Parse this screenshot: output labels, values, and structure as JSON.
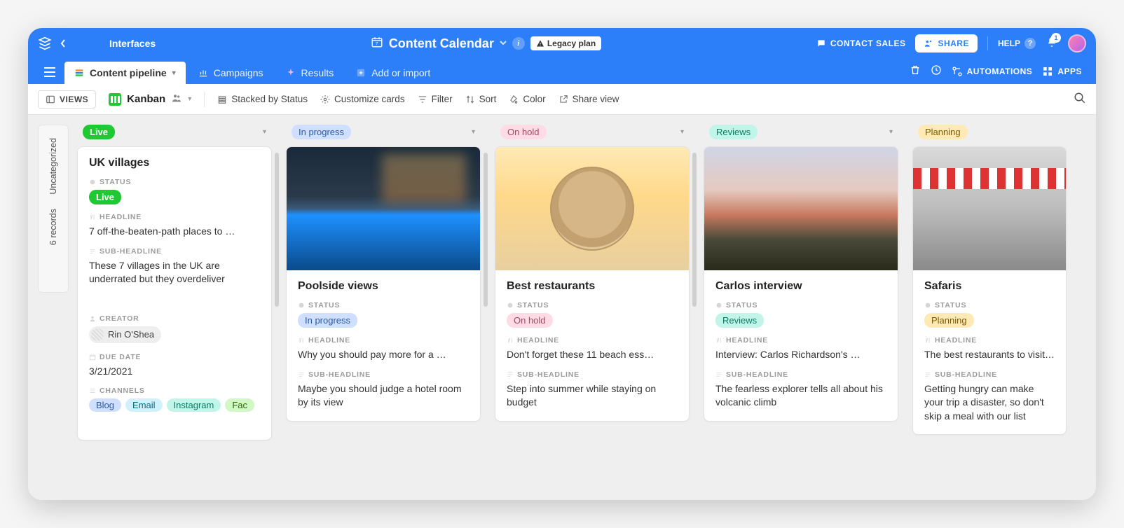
{
  "header": {
    "interfaces": "Interfaces",
    "base_title": "Content Calendar",
    "legacy": "Legacy plan",
    "contact_sales": "CONTACT SALES",
    "share": "SHARE",
    "help": "HELP",
    "notify_count": "1"
  },
  "tabs": {
    "content_pipeline": "Content pipeline",
    "campaigns": "Campaigns",
    "results": "Results",
    "add_import": "Add or import",
    "automations": "AUTOMATIONS",
    "apps": "APPS"
  },
  "toolbar": {
    "views": "VIEWS",
    "view_name": "Kanban",
    "stacked": "Stacked by Status",
    "customize": "Customize cards",
    "filter": "Filter",
    "sort": "Sort",
    "color": "Color",
    "share_view": "Share view"
  },
  "side": {
    "uncategorized": "Uncategorized",
    "records": "6 records"
  },
  "labels": {
    "status": "STATUS",
    "headline": "HEADLINE",
    "subheadline": "SUB-HEADLINE",
    "creator": "CREATOR",
    "due_date": "DUE DATE",
    "channels": "CHANNELS"
  },
  "columns": {
    "live": {
      "label": "Live",
      "card": {
        "title": "UK villages",
        "status": "Live",
        "headline": "7 off-the-beaten-path places to …",
        "subheadline": "These 7 villages in the UK are underrated but they overdeliver",
        "creator": "Rin O'Shea",
        "due_date": "3/21/2021",
        "channels": {
          "blog": "Blog",
          "email": "Email",
          "instagram": "Instagram",
          "fac": "Fac"
        }
      }
    },
    "in_progress": {
      "label": "In progress",
      "card": {
        "title": "Poolside views",
        "status": "In progress",
        "headline": "Why you should pay more for a …",
        "subheadline": "Maybe you should judge a hotel room by its view"
      }
    },
    "on_hold": {
      "label": "On hold",
      "card": {
        "title": "Best restaurants",
        "status": "On hold",
        "headline": "Don't forget these 11 beach ess…",
        "subheadline": "Step into summer while staying on budget"
      }
    },
    "reviews": {
      "label": "Reviews",
      "card": {
        "title": "Carlos interview",
        "status": "Reviews",
        "headline": "Interview: Carlos Richardson's …",
        "subheadline": "The fearless explorer tells all about his volcanic climb"
      }
    },
    "planning": {
      "label": "Planning",
      "card": {
        "title": "Safaris",
        "status": "Planning",
        "headline": "The best restaurants to visit t…",
        "subheadline": "Getting hungry can make your trip a disaster, so don't skip a meal with our list"
      }
    }
  }
}
